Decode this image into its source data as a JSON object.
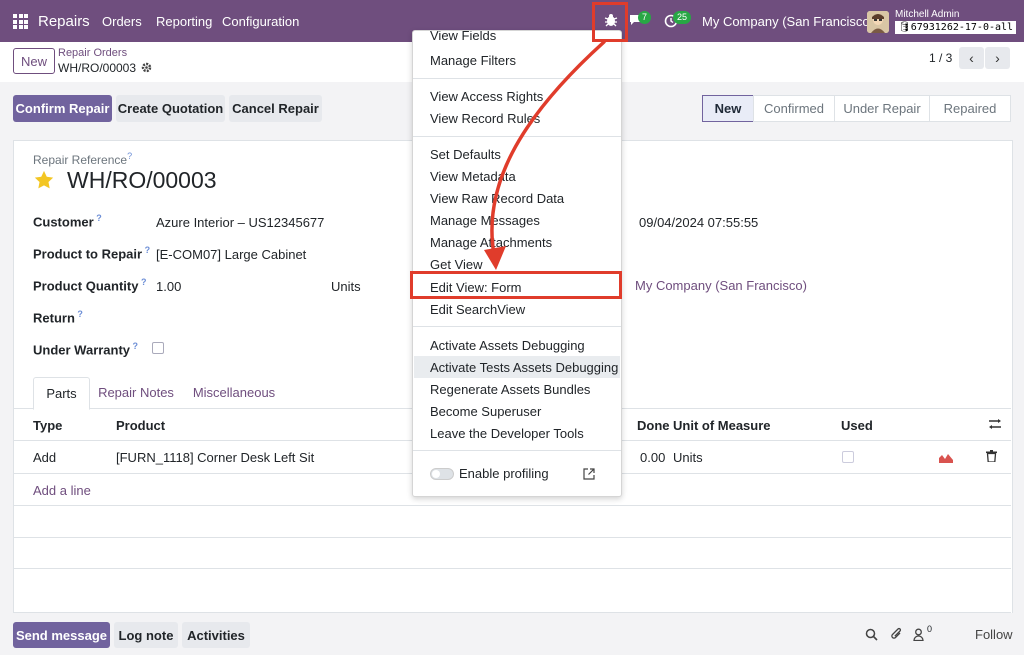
{
  "navbar": {
    "app_name": "Repairs",
    "menus": [
      "Orders",
      "Reporting",
      "Configuration"
    ],
    "messages_count": "7",
    "activities_count": "25",
    "company": "My Company (San Francisco)",
    "user": "Mitchell Admin",
    "db": "67931262-17-0-all",
    "icons": [
      "apps-grid-icon",
      "bug-icon",
      "chat-icon",
      "clock-icon",
      "database-icon"
    ]
  },
  "control_panel": {
    "new_label": "New",
    "breadcrumb_parent": "Repair Orders",
    "record_name": "WH/RO/00003",
    "pager": "1 / 3"
  },
  "actions": {
    "confirm": "Confirm Repair",
    "quotation": "Create Quotation",
    "cancel": "Cancel Repair"
  },
  "statusbar": [
    "New",
    "Confirmed",
    "Under Repair",
    "Repaired"
  ],
  "form": {
    "ref_label": "Repair Reference",
    "ref_value": "WH/RO/00003",
    "customer_label": "Customer",
    "customer_value": "Azure Interior – US12345677",
    "product_label": "Product to Repair",
    "product_value": "[E-COM07] Large Cabinet",
    "qty_label": "Product Quantity",
    "qty_value": "1.00",
    "qty_uom": "Units",
    "return_label": "Return",
    "warranty_label": "Under Warranty",
    "date_value": "09/04/2024 07:55:55",
    "company_value": "My Company (San Francisco)"
  },
  "tabs": [
    "Parts",
    "Repair Notes",
    "Miscellaneous"
  ],
  "table": {
    "headers": {
      "type": "Type",
      "product": "Product",
      "done": "Done",
      "uom": "Unit of Measure",
      "used": "Used"
    },
    "rows": [
      {
        "type": "Add",
        "product": "[FURN_1118] Corner Desk Left Sit",
        "done": "0.00",
        "uom": "Units"
      }
    ],
    "add_line": "Add a line"
  },
  "dropdown": {
    "partial_top": "View Fields",
    "items": [
      "Manage Filters",
      "View Access Rights",
      "View Record Rules",
      "Set Defaults",
      "View Metadata",
      "View Raw Record Data",
      "Manage Messages",
      "Manage Attachments",
      "Get View",
      "Edit View: Form",
      "Edit SearchView",
      "Activate Assets Debugging",
      "Activate Tests Assets Debugging",
      "Regenerate Assets Bundles",
      "Become Superuser",
      "Leave the Developer Tools"
    ],
    "profiling": "Enable profiling"
  },
  "chatter": {
    "send": "Send message",
    "log": "Log note",
    "activities": "Activities",
    "attachments_count": "0",
    "follow": "Follow"
  },
  "colors": {
    "navbar": "#6f4e7e",
    "primary": "#71639e",
    "annotation": "#e03c2b",
    "badge": "#28a745"
  }
}
